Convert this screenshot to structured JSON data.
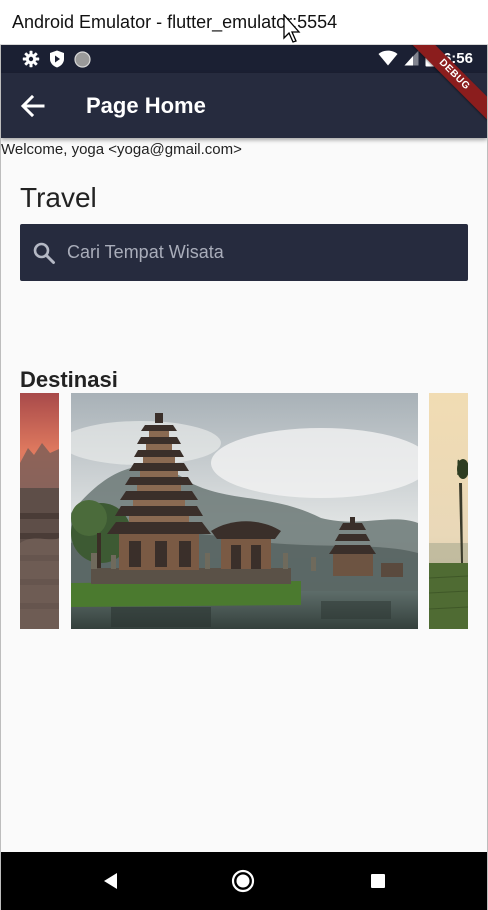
{
  "window": {
    "title": "Android Emulator - flutter_emulator:5554"
  },
  "status_bar": {
    "time": "6:56",
    "left_icons": [
      "settings-icon",
      "shield-play-icon",
      "circle-icon"
    ],
    "right_icons": [
      "wifi-icon",
      "cellular-signal-icon",
      "battery-icon"
    ]
  },
  "debug_banner": "DEBUG",
  "app_bar": {
    "back_icon": "arrow-left-icon",
    "title": "Page Home"
  },
  "welcome": "Welcome, yoga <yoga@gmail.com>",
  "heading": "Travel",
  "search": {
    "icon": "search-icon",
    "placeholder": "Cari Tempat Wisata",
    "value": ""
  },
  "section_title": "Destinasi",
  "destinations": [
    {
      "image": "temple-sunset"
    },
    {
      "image": "balinese-temple-lake"
    },
    {
      "image": "rice-field-palm"
    }
  ],
  "nav_bar": {
    "icons": [
      "nav-back-icon",
      "nav-home-icon",
      "nav-recents-icon"
    ]
  },
  "colors": {
    "status_bar": "#1b2033",
    "app_bar": "#262b3e",
    "search_bg": "#262b3e",
    "page_bg": "#fafafa",
    "debug_ribbon": "#8b1d1d",
    "nav_bar": "#000000"
  }
}
